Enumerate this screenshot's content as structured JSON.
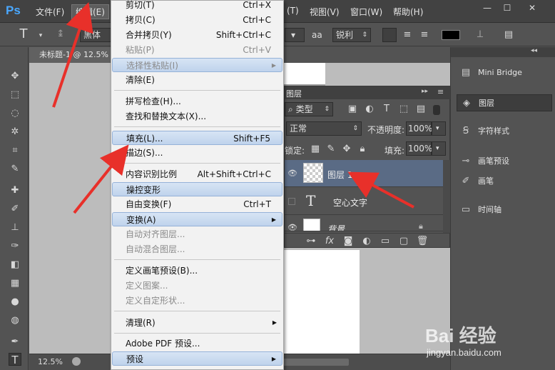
{
  "app": {
    "logo": "Ps",
    "menus": [
      "文件(F)",
      "编辑(E)",
      "(T)",
      "视图(V)",
      "窗口(W)",
      "帮助(H)"
    ],
    "window_buttons": [
      "—",
      "☐",
      "✕"
    ]
  },
  "options": {
    "font_family": "黑体",
    "aa_icon": "aa",
    "antialias": "锐利"
  },
  "document": {
    "tab_title": "未标题-1 @ 12.5%",
    "zoom": "12.5%"
  },
  "edit_menu": {
    "items": [
      {
        "label": "剪切(T)",
        "shortcut": "Ctrl+X"
      },
      {
        "label": "拷贝(C)",
        "shortcut": "Ctrl+C"
      },
      {
        "label": "合并拷贝(Y)",
        "shortcut": "Shift+Ctrl+C"
      },
      {
        "label": "粘贴(P)",
        "shortcut": "Ctrl+V"
      },
      {
        "label": "选择性粘贴(I)",
        "shortcut": ""
      },
      {
        "label": "清除(E)",
        "shortcut": ""
      },
      {
        "label": "拼写检查(H)...",
        "shortcut": ""
      },
      {
        "label": "查找和替换文本(X)...",
        "shortcut": ""
      },
      {
        "label": "填充(L)...",
        "shortcut": "Shift+F5"
      },
      {
        "label": "描边(S)...",
        "shortcut": ""
      },
      {
        "label": "内容识别比例",
        "shortcut": "Alt+Shift+Ctrl+C"
      },
      {
        "label": "操控变形",
        "shortcut": ""
      },
      {
        "label": "自由变换(F)",
        "shortcut": "Ctrl+T"
      },
      {
        "label": "变换(A)",
        "shortcut": ""
      },
      {
        "label": "自动对齐图层...",
        "shortcut": ""
      },
      {
        "label": "自动混合图层...",
        "shortcut": ""
      },
      {
        "label": "定义画笔预设(B)...",
        "shortcut": ""
      },
      {
        "label": "定义图案...",
        "shortcut": ""
      },
      {
        "label": "定义自定形状...",
        "shortcut": ""
      },
      {
        "label": "清理(R)",
        "shortcut": ""
      },
      {
        "label": "Adobe PDF 预设...",
        "shortcut": ""
      },
      {
        "label": "预设",
        "shortcut": ""
      }
    ]
  },
  "layers": {
    "tab_label": "图层",
    "filter_kind": "类型",
    "blend_mode": "正常",
    "opacity_label": "不透明度:",
    "opacity_value": "100%",
    "lock_label": "锁定:",
    "fill_label": "填充:",
    "fill_value": "100%",
    "rows": [
      {
        "name": "图层 1"
      },
      {
        "name": "空心文字"
      },
      {
        "name": "背景"
      }
    ]
  },
  "right_panels": {
    "items": [
      "Mini Bridge",
      "图层",
      "字符样式",
      "画笔预设",
      "画笔",
      "时间轴"
    ]
  },
  "watermark": {
    "brand": "Bai 经验",
    "url": "jingyan.baidu.com"
  }
}
